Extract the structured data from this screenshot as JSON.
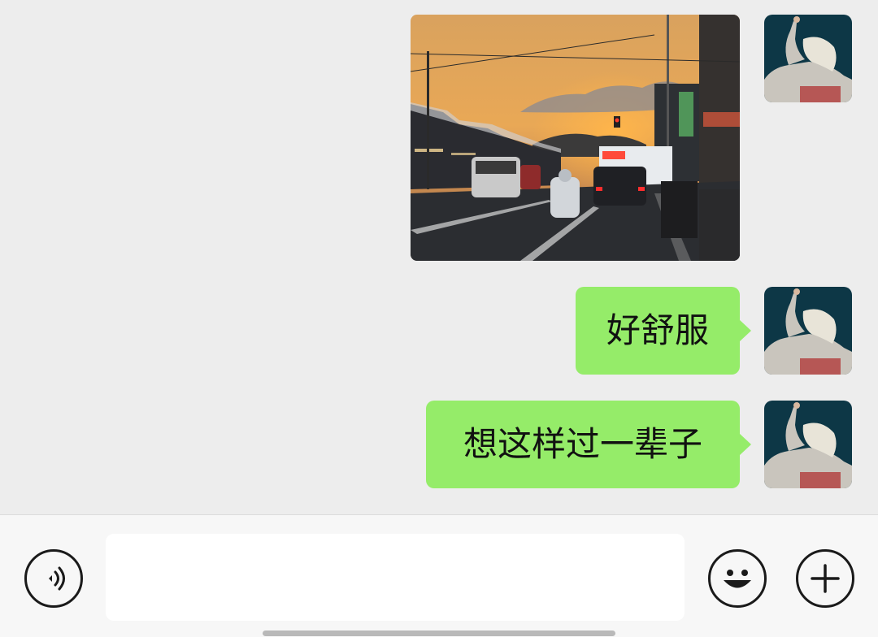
{
  "chat": {
    "messages": [
      {
        "type": "image",
        "description_icon": "photo-thumbnail"
      },
      {
        "type": "text",
        "text": "好舒服"
      },
      {
        "type": "text",
        "text": "想这样过一辈子"
      }
    ]
  },
  "input_bar": {
    "voice_icon": "voice-icon",
    "input_value": "",
    "emoji_icon": "emoji-icon",
    "plus_icon": "plus-icon"
  },
  "colors": {
    "bubble": "#95ec69",
    "background": "#ededed",
    "input_bar": "#f7f7f7"
  }
}
